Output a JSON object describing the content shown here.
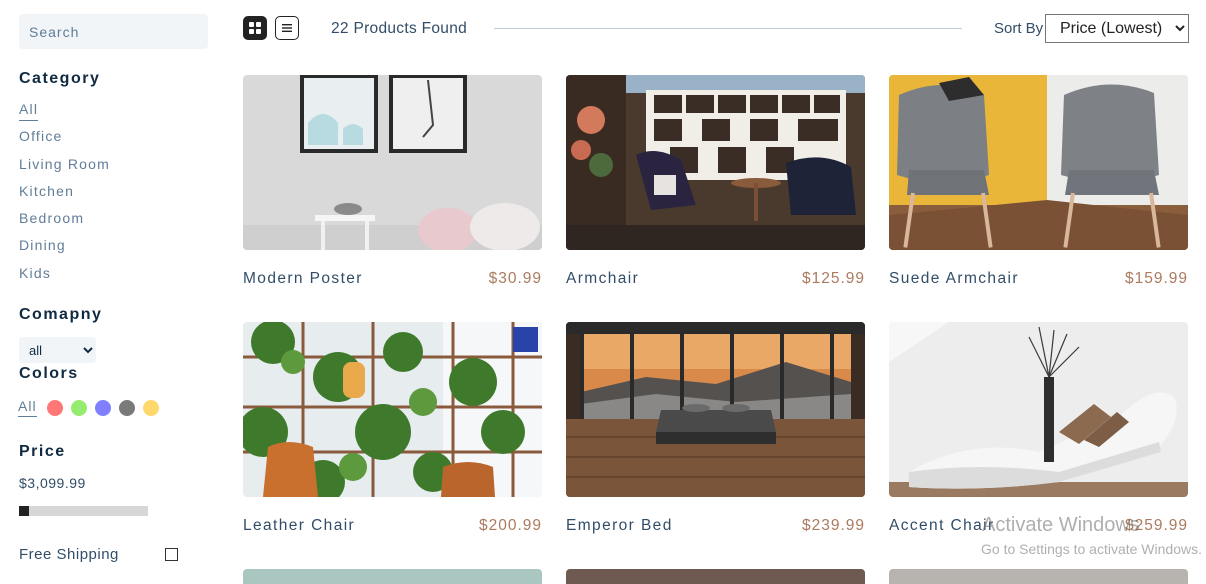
{
  "search": {
    "placeholder": "Search"
  },
  "filters": {
    "category": {
      "heading": "Category",
      "items": [
        "All",
        "Office",
        "Living Room",
        "Kitchen",
        "Bedroom",
        "Dining",
        "Kids"
      ]
    },
    "company": {
      "heading": "Comapny",
      "selected": "all"
    },
    "colors": {
      "heading": "Colors",
      "all_label": "All",
      "swatches": [
        "#ff7875",
        "#95ec6f",
        "#8080ff",
        "#7a7a7a",
        "#ffd86b"
      ]
    },
    "price": {
      "heading": "Price",
      "value": "$3,099.99",
      "fraction": 0.0
    },
    "shipping": {
      "label": "Free Shipping",
      "checked": false
    }
  },
  "toolbar": {
    "grid_view": "grid-view-icon",
    "list_view": "list-view-icon",
    "count": "22 Products Found",
    "sort_label": "Sort By",
    "sort_selected": "Price (Lowest)"
  },
  "products": [
    {
      "name": "Modern Poster",
      "price": "$30.99"
    },
    {
      "name": "Armchair",
      "price": "$125.99"
    },
    {
      "name": "Suede Armchair",
      "price": "$159.99"
    },
    {
      "name": "Leather Chair",
      "price": "$200.99"
    },
    {
      "name": "Emperor Bed",
      "price": "$239.99"
    },
    {
      "name": "Accent Chair",
      "price": "$259.99"
    }
  ],
  "watermark": {
    "line1": "Activate Windows",
    "line2": "Go to Settings to activate Windows."
  }
}
